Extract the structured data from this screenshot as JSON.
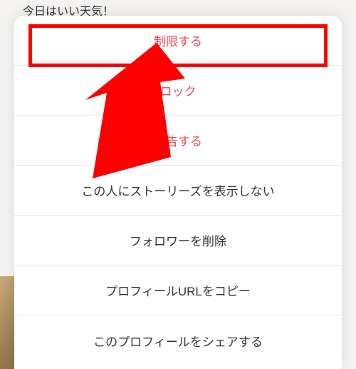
{
  "background": {
    "caption": "今日はいい天気！"
  },
  "menu": {
    "restrict": "制限する",
    "block": "ロック",
    "report": "報告する",
    "hide_story": "この人にストーリーズを表示しない",
    "remove_follower": "フォロワーを削除",
    "copy_url": "プロフィールURLをコピー",
    "share_profile": "このプロフィールをシェアする"
  },
  "annotation": {
    "highlight_target": "restrict",
    "arrow_color": "#ff0000"
  }
}
